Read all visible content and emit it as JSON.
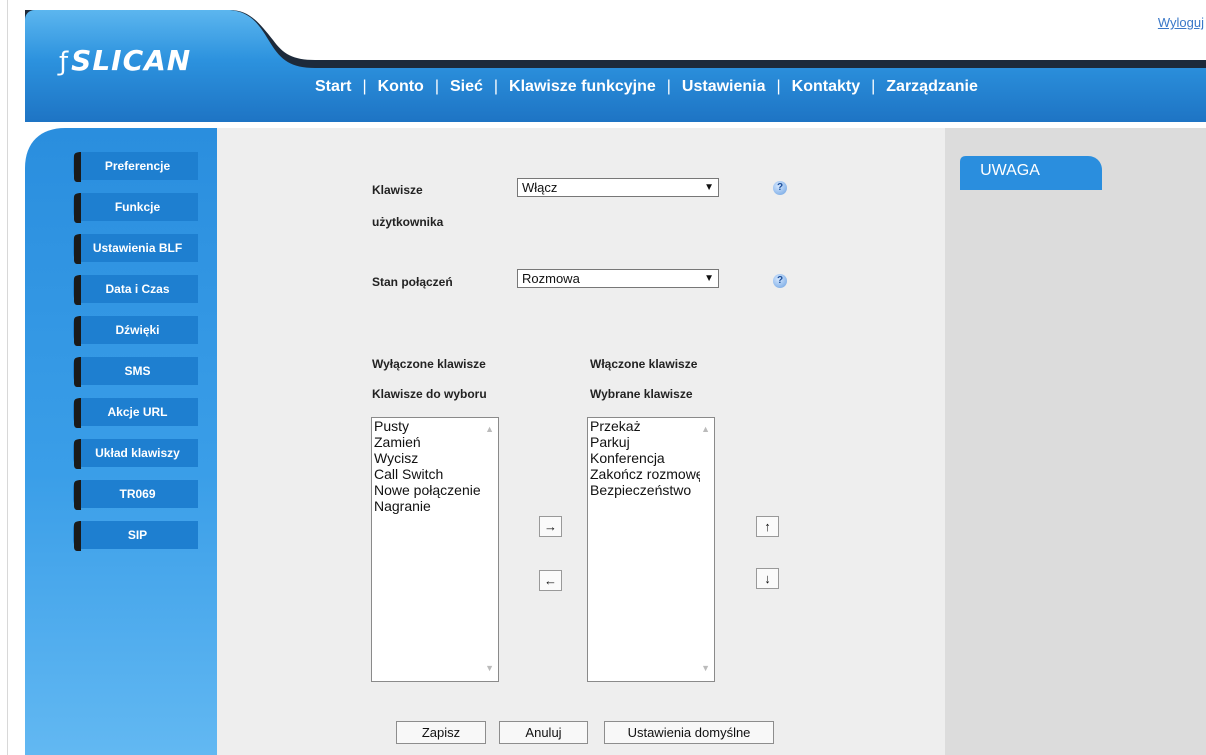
{
  "header": {
    "logout": "Wyloguj",
    "logo": "SLICAN",
    "logo_mark": "ƒ",
    "nav": [
      {
        "label": "Start"
      },
      {
        "label": "Konto"
      },
      {
        "label": "Sieć"
      },
      {
        "label": "Klawisze funkcyjne"
      },
      {
        "label": "Ustawienia",
        "active": true
      },
      {
        "label": "Kontakty"
      },
      {
        "label": "Zarządzanie"
      }
    ],
    "separator": "|"
  },
  "sidebar": {
    "items": [
      {
        "label": "Preferencje"
      },
      {
        "label": "Funkcje"
      },
      {
        "label": "Ustawienia BLF"
      },
      {
        "label": "Data i Czas"
      },
      {
        "label": "Dźwięki"
      },
      {
        "label": "SMS"
      },
      {
        "label": "Akcje URL"
      },
      {
        "label": "Układ klawiszy",
        "active": true
      },
      {
        "label": "TR069"
      },
      {
        "label": "SIP"
      }
    ]
  },
  "form": {
    "user_keys_label_1": "Klawisze",
    "user_keys_label_2": "użytkownika",
    "user_keys_value": "Włącz",
    "call_state_label": "Stan połączeń",
    "call_state_value": "Rozmowa",
    "disabled_title": "Wyłączone klawisze",
    "available_title": "Klawisze do wyboru",
    "enabled_title": "Włączone klawisze",
    "selected_title": "Wybrane klawisze",
    "available_keys": [
      "Pusty",
      "Zamień",
      "Wycisz",
      "Call Switch",
      "Nowe połączenie",
      "Nagranie"
    ],
    "selected_keys": [
      "Przekaż",
      "Parkuj",
      "Konferencja",
      "Zakończ rozmowę",
      "Bezpieczeństwo"
    ],
    "arrow_right": "→",
    "arrow_left": "←",
    "arrow_up": "↑",
    "arrow_down": "↓",
    "help_glyph": "?",
    "dropdown_glyph": "▼",
    "scroll_up_glyph": "▲",
    "scroll_down_glyph": "▼"
  },
  "buttons": {
    "save": "Zapisz",
    "cancel": "Anuluj",
    "defaults": "Ustawienia domyślne"
  },
  "notes": {
    "title": "UWAGA"
  },
  "colors": {
    "brand_blue": "#2f8fd8",
    "header_dark": "#1d2a3a",
    "sidebar_pill": "#2b86d4",
    "main_bg": "#eeeeee",
    "notes_bg": "#dcdcdc"
  }
}
